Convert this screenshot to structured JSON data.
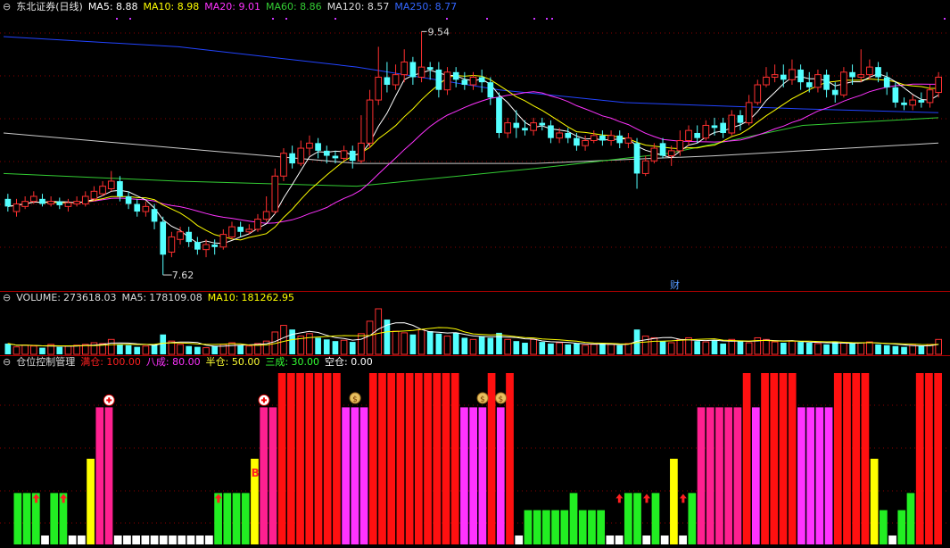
{
  "kline": {
    "title": "东北证券(日线)",
    "ma": [
      {
        "label": "MA5",
        "value": "8.88",
        "color": "#ffffff"
      },
      {
        "label": "MA10",
        "value": "8.98",
        "color": "#ffff00"
      },
      {
        "label": "MA20",
        "value": "9.01",
        "color": "#ff33ff"
      },
      {
        "label": "MA60",
        "value": "8.86",
        "color": "#33cc33"
      },
      {
        "label": "MA120",
        "value": "8.57",
        "color": "#dddddd"
      },
      {
        "label": "MA250",
        "value": "8.77",
        "color": "#3366ff"
      }
    ],
    "high_label": "9.54",
    "low_label": "7.62",
    "event_marker": "财",
    "candles": [
      [
        8.22,
        8.16,
        8.26,
        8.12
      ],
      [
        8.12,
        8.18,
        8.22,
        8.08
      ],
      [
        8.16,
        8.2,
        8.24,
        8.14
      ],
      [
        8.2,
        8.24,
        8.28,
        8.18
      ],
      [
        8.22,
        8.18,
        8.26,
        8.16
      ],
      [
        8.18,
        8.2,
        8.24,
        8.16
      ],
      [
        8.2,
        8.17,
        8.23,
        8.14
      ],
      [
        8.16,
        8.19,
        8.22,
        8.12
      ],
      [
        8.18,
        8.2,
        8.24,
        8.16
      ],
      [
        8.18,
        8.24,
        8.28,
        8.16
      ],
      [
        8.22,
        8.28,
        8.32,
        8.2
      ],
      [
        8.26,
        8.32,
        8.36,
        8.24
      ],
      [
        8.3,
        8.36,
        8.44,
        8.28
      ],
      [
        8.36,
        8.24,
        8.4,
        8.2
      ],
      [
        8.24,
        8.18,
        8.28,
        8.14
      ],
      [
        8.18,
        8.12,
        8.22,
        8.08
      ],
      [
        8.12,
        8.16,
        8.2,
        8.08
      ],
      [
        8.14,
        8.04,
        8.18,
        7.98
      ],
      [
        8.04,
        7.78,
        8.08,
        7.62
      ],
      [
        7.8,
        7.92,
        7.96,
        7.76
      ],
      [
        7.9,
        7.96,
        8.0,
        7.86
      ],
      [
        7.96,
        7.88,
        8.0,
        7.84
      ],
      [
        7.88,
        7.82,
        7.92,
        7.78
      ],
      [
        7.82,
        7.86,
        7.9,
        7.76
      ],
      [
        7.86,
        7.84,
        7.9,
        7.78
      ],
      [
        7.84,
        7.94,
        7.98,
        7.82
      ],
      [
        7.92,
        8.0,
        8.04,
        7.9
      ],
      [
        8.0,
        7.96,
        8.04,
        7.92
      ],
      [
        7.96,
        7.98,
        8.02,
        7.94
      ],
      [
        7.98,
        8.06,
        8.1,
        7.96
      ],
      [
        8.06,
        8.12,
        8.24,
        8.04
      ],
      [
        8.12,
        8.4,
        8.46,
        8.1
      ],
      [
        8.4,
        8.58,
        8.62,
        8.36
      ],
      [
        8.58,
        8.5,
        8.64,
        8.46
      ],
      [
        8.5,
        8.62,
        8.68,
        8.48
      ],
      [
        8.62,
        8.66,
        8.72,
        8.56
      ],
      [
        8.66,
        8.6,
        8.7,
        8.54
      ],
      [
        8.6,
        8.56,
        8.64,
        8.5
      ],
      [
        8.56,
        8.54,
        8.6,
        8.5
      ],
      [
        8.54,
        8.6,
        8.64,
        8.52
      ],
      [
        8.6,
        8.52,
        8.64,
        8.46
      ],
      [
        8.52,
        8.66,
        8.88,
        8.5
      ],
      [
        8.66,
        9.0,
        9.08,
        8.62
      ],
      [
        9.0,
        9.18,
        9.42,
        8.96
      ],
      [
        9.18,
        9.12,
        9.3,
        9.06
      ],
      [
        9.12,
        9.2,
        9.28,
        9.08
      ],
      [
        9.2,
        9.3,
        9.4,
        9.14
      ],
      [
        9.3,
        9.18,
        9.34,
        9.12
      ],
      [
        9.18,
        9.26,
        9.54,
        9.14
      ],
      [
        9.26,
        9.24,
        9.3,
        9.16
      ],
      [
        9.24,
        9.08,
        9.3,
        9.02
      ],
      [
        9.08,
        9.22,
        9.26,
        9.04
      ],
      [
        9.22,
        9.16,
        9.26,
        9.1
      ],
      [
        9.16,
        9.12,
        9.22,
        9.08
      ],
      [
        9.12,
        9.18,
        9.22,
        9.08
      ],
      [
        9.18,
        9.14,
        9.24,
        9.06
      ],
      [
        9.14,
        9.02,
        9.18,
        8.96
      ],
      [
        9.02,
        8.74,
        9.06,
        8.7
      ],
      [
        8.74,
        8.82,
        8.86,
        8.7
      ],
      [
        8.82,
        8.78,
        8.92,
        8.7
      ],
      [
        8.78,
        8.76,
        8.84,
        8.72
      ],
      [
        8.76,
        8.82,
        8.86,
        8.72
      ],
      [
        8.82,
        8.8,
        8.86,
        8.76
      ],
      [
        8.8,
        8.7,
        8.84,
        8.66
      ],
      [
        8.7,
        8.74,
        8.78,
        8.66
      ],
      [
        8.74,
        8.7,
        8.78,
        8.66
      ],
      [
        8.7,
        8.64,
        8.74,
        8.6
      ],
      [
        8.64,
        8.68,
        8.72,
        8.6
      ],
      [
        8.68,
        8.72,
        8.76,
        8.66
      ],
      [
        8.72,
        8.68,
        8.76,
        8.64
      ],
      [
        8.68,
        8.72,
        8.76,
        8.64
      ],
      [
        8.72,
        8.66,
        8.76,
        8.62
      ],
      [
        8.66,
        8.7,
        8.74,
        8.62
      ],
      [
        8.66,
        8.42,
        8.7,
        8.3
      ],
      [
        8.42,
        8.52,
        8.56,
        8.4
      ],
      [
        8.52,
        8.62,
        8.66,
        8.5
      ],
      [
        8.66,
        8.56,
        8.7,
        8.54
      ],
      [
        8.56,
        8.6,
        8.64,
        8.48
      ],
      [
        8.6,
        8.68,
        8.76,
        8.56
      ],
      [
        8.68,
        8.76,
        8.8,
        8.64
      ],
      [
        8.74,
        8.7,
        8.8,
        8.66
      ],
      [
        8.7,
        8.8,
        8.84,
        8.68
      ],
      [
        8.8,
        8.78,
        8.86,
        8.72
      ],
      [
        8.82,
        8.74,
        8.86,
        8.7
      ],
      [
        8.74,
        8.88,
        8.92,
        8.72
      ],
      [
        8.88,
        8.82,
        8.92,
        8.76
      ],
      [
        8.82,
        8.98,
        9.04,
        8.8
      ],
      [
        8.98,
        9.12,
        9.16,
        8.96
      ],
      [
        9.12,
        9.18,
        9.26,
        9.1
      ],
      [
        9.18,
        9.2,
        9.28,
        9.14
      ],
      [
        9.2,
        9.16,
        9.28,
        9.1
      ],
      [
        9.16,
        9.24,
        9.32,
        9.12
      ],
      [
        9.24,
        9.14,
        9.28,
        9.08
      ],
      [
        9.14,
        9.1,
        9.22,
        9.06
      ],
      [
        9.1,
        9.2,
        9.24,
        9.06
      ],
      [
        9.2,
        9.08,
        9.24,
        9.02
      ],
      [
        9.08,
        9.04,
        9.14,
        8.98
      ],
      [
        9.04,
        9.22,
        9.26,
        9.02
      ],
      [
        9.22,
        9.18,
        9.28,
        9.12
      ],
      [
        9.18,
        9.2,
        9.4,
        9.14
      ],
      [
        9.2,
        9.26,
        9.32,
        9.16
      ],
      [
        9.26,
        9.18,
        9.3,
        9.14
      ],
      [
        9.18,
        9.1,
        9.22,
        9.04
      ],
      [
        9.1,
        8.98,
        9.14,
        8.94
      ],
      [
        8.98,
        8.96,
        9.02,
        8.92
      ],
      [
        8.96,
        9.0,
        9.04,
        8.92
      ],
      [
        9.0,
        8.98,
        9.06,
        8.94
      ],
      [
        8.98,
        9.08,
        9.12,
        8.94
      ],
      [
        9.06,
        9.18,
        9.22,
        9.02
      ]
    ]
  },
  "volume": {
    "label": "VOLUME:",
    "value": "273618.03",
    "ma5_label": "MA5:",
    "ma5": "178109.08",
    "ma10_label": "MA10:",
    "ma10": "181262.95",
    "bars": [
      13,
      9,
      11,
      10,
      8,
      12,
      9,
      10,
      11,
      12,
      14,
      13,
      18,
      12,
      11,
      9,
      10,
      12,
      24,
      16,
      12,
      10,
      9,
      8,
      10,
      12,
      14,
      11,
      10,
      13,
      16,
      27,
      35,
      30,
      22,
      25,
      20,
      18,
      16,
      17,
      15,
      25,
      40,
      55,
      42,
      28,
      26,
      24,
      30,
      28,
      25,
      22,
      26,
      20,
      18,
      22,
      20,
      26,
      18,
      16,
      14,
      18,
      15,
      13,
      14,
      12,
      13,
      11,
      12,
      13,
      12,
      11,
      13,
      30,
      22,
      20,
      16,
      14,
      18,
      20,
      16,
      15,
      17,
      13,
      18,
      16,
      14,
      20,
      18,
      15,
      14,
      16,
      15,
      14,
      13,
      12,
      15,
      14,
      13,
      14,
      15,
      12,
      11,
      10,
      9,
      11,
      10,
      12,
      18
    ]
  },
  "position": {
    "title": "仓位控制管理",
    "legend": [
      {
        "label": "满仓:",
        "value": "100.00",
        "color": "#ff2020"
      },
      {
        "label": "八成:",
        "value": "80.00",
        "color": "#ff33ff"
      },
      {
        "label": "半仓:",
        "value": "50.00",
        "color": "#ffff33"
      },
      {
        "label": "三成:",
        "value": "30.00",
        "color": "#33ff33"
      },
      {
        "label": "空仓:",
        "value": "0.00",
        "color": "#ffffff"
      }
    ],
    "b_marker": "B",
    "levels": [
      30,
      30,
      30,
      0,
      30,
      30,
      0,
      0,
      50,
      80,
      80,
      0,
      0,
      0,
      0,
      0,
      0,
      0,
      0,
      0,
      0,
      0,
      30,
      30,
      30,
      30,
      50,
      80,
      80,
      100,
      100,
      100,
      100,
      100,
      100,
      100,
      80,
      80,
      80,
      100,
      100,
      100,
      100,
      100,
      100,
      100,
      100,
      100,
      100,
      80,
      80,
      80,
      100,
      80,
      100,
      0,
      20,
      20,
      20,
      20,
      20,
      30,
      20,
      20,
      20,
      0,
      0,
      30,
      30,
      0,
      30,
      0,
      50,
      0,
      30,
      80,
      80,
      80,
      80,
      80,
      100,
      80,
      100,
      100,
      100,
      100,
      80,
      80,
      80,
      80,
      100,
      100,
      100,
      100,
      50,
      20,
      0,
      20,
      30,
      100,
      100,
      100
    ],
    "money_markers": [
      37,
      51,
      53
    ],
    "plus_markers": [
      10,
      27
    ],
    "arrow_markers": [
      2,
      5,
      22,
      66,
      69,
      73
    ]
  }
}
